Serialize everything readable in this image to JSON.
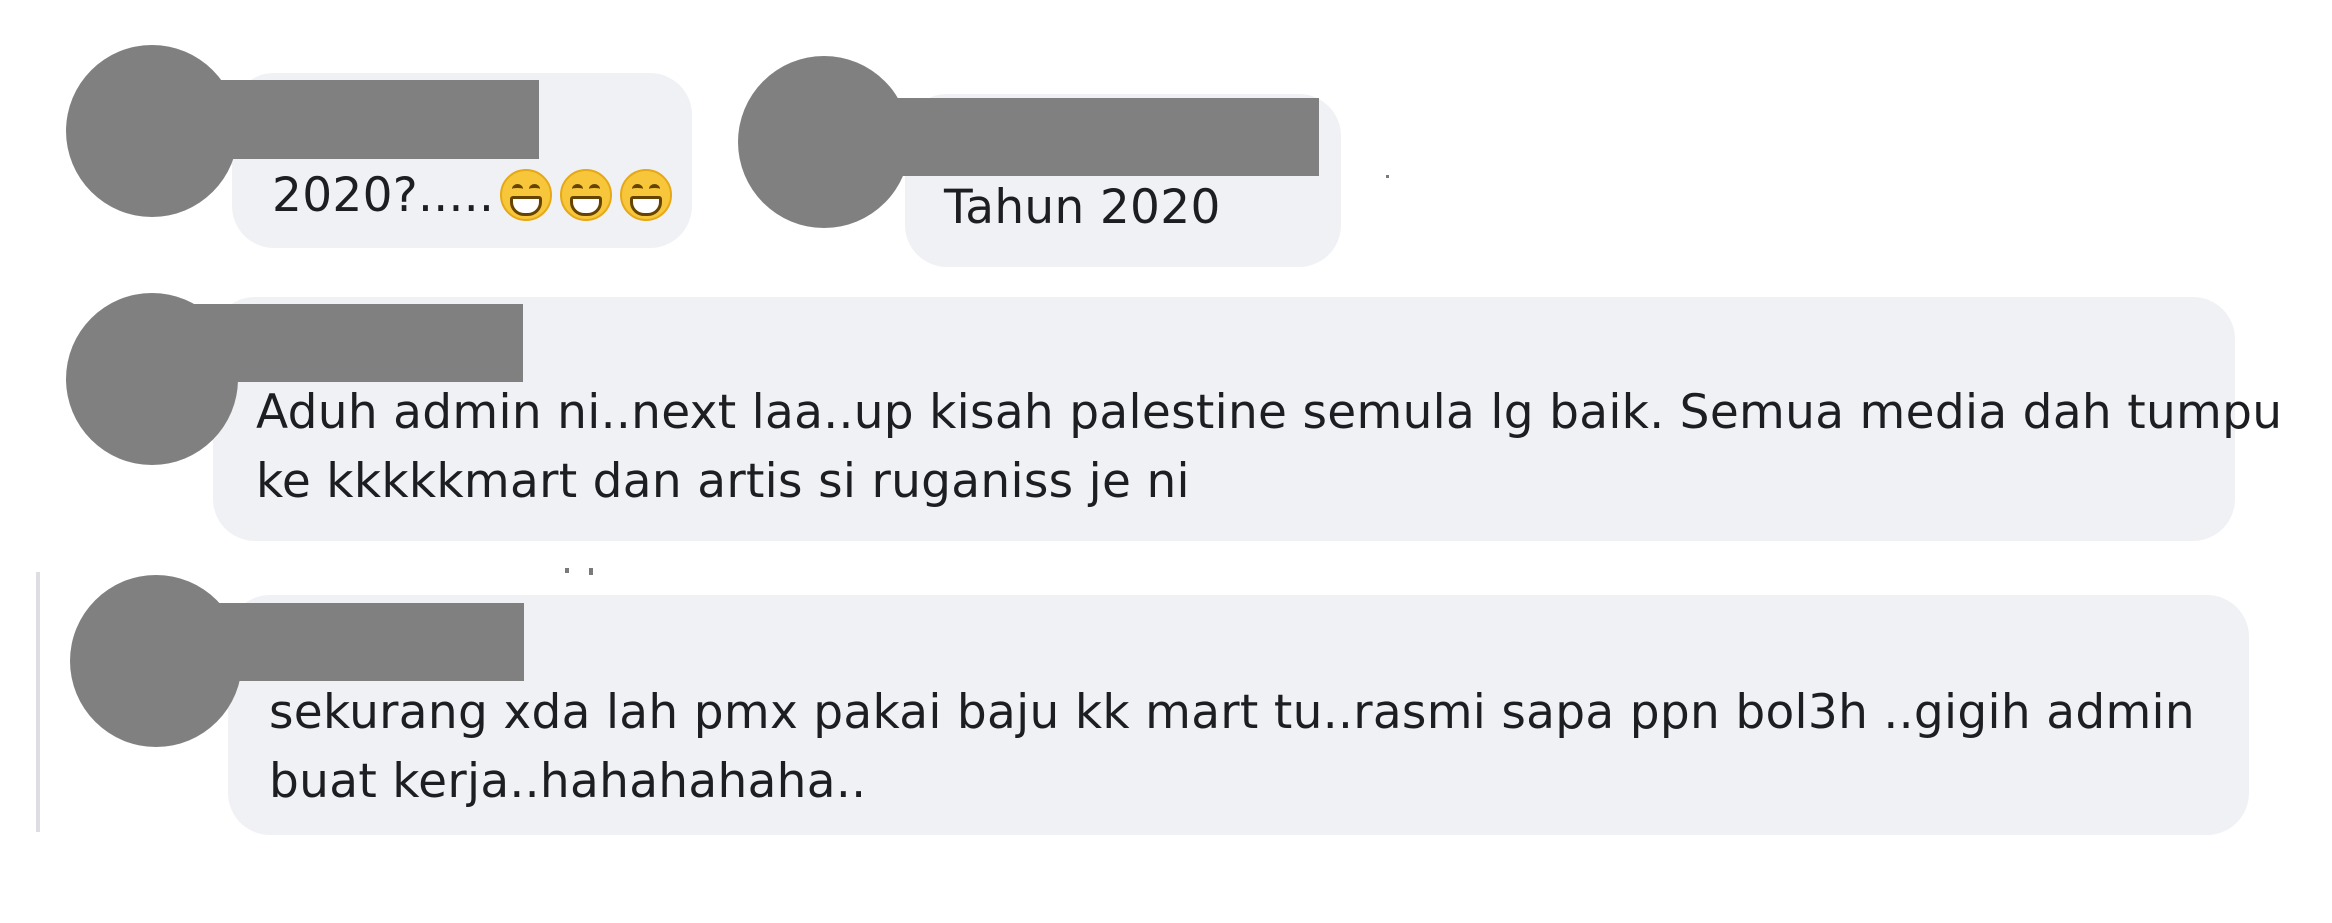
{
  "comments": [
    {
      "author_redacted": true,
      "text": "2020?.....",
      "emoji": [
        "beaming-face-with-smiling-eyes",
        "beaming-face-with-smiling-eyes",
        "beaming-face-with-smiling-eyes"
      ]
    },
    {
      "author_redacted": true,
      "text": "Tahun 2020"
    },
    {
      "author_redacted": true,
      "lines": [
        "Aduh admin ni..next laa..up kisah palestine semula lg baik. Semua media dah tumpu",
        "ke kkkkkmart dan artis si ruganiss je ni"
      ]
    },
    {
      "author_redacted": true,
      "lines": [
        "sekurang xda lah pmx pakai baju kk mart tu..rasmi sapa ppn bol3h ..gigih admin",
        "buat kerja..hahahahaha.."
      ]
    }
  ],
  "colors": {
    "bubble": "#f0f1f5",
    "redaction": "#808080",
    "text": "#1c1e21"
  }
}
